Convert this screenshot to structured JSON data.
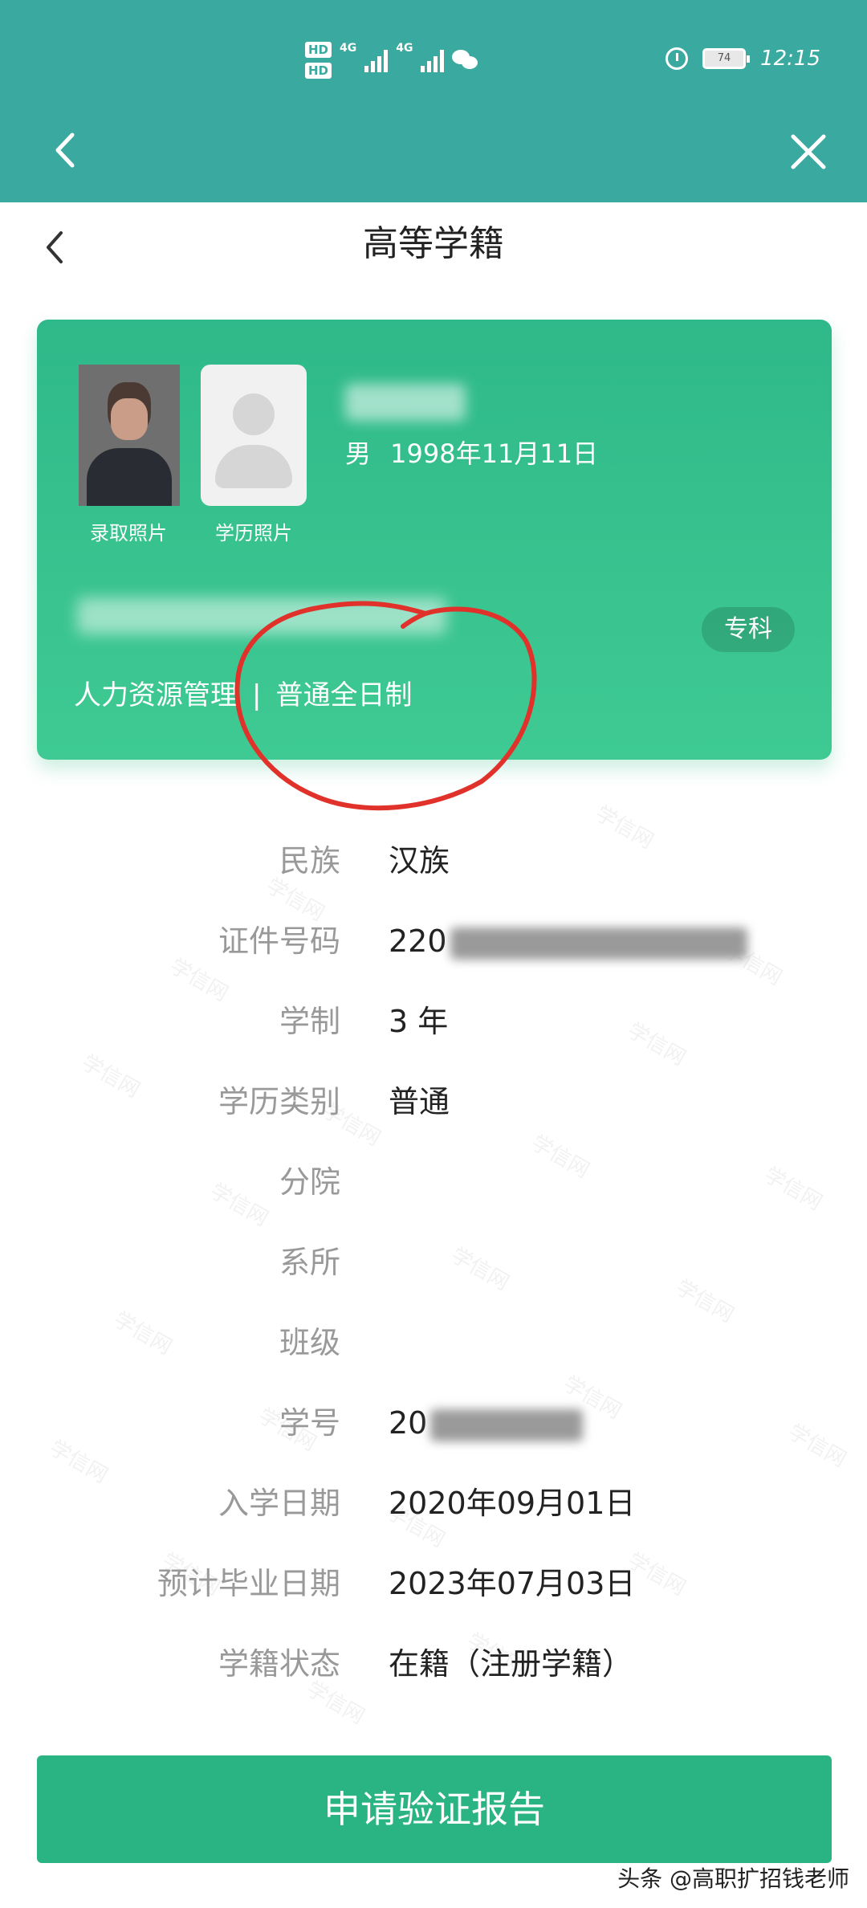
{
  "status_bar": {
    "hd1": "HD",
    "hd2": "HD",
    "net1": "4G",
    "net2": "4G",
    "battery": "74",
    "time": "12:15"
  },
  "page": {
    "title": "高等学籍"
  },
  "card": {
    "photo_label_1": "录取照片",
    "photo_label_2": "学历照片",
    "gender_dob": "男 1998年11月11日",
    "level_badge": "专科",
    "major": "人力资源管理",
    "separator": "|",
    "study_mode": "普通全日制"
  },
  "fields": [
    {
      "label": "民族",
      "value": "汉族"
    },
    {
      "label": "证件号码",
      "value": "220"
    },
    {
      "label": "学制",
      "value": "3 年"
    },
    {
      "label": "学历类别",
      "value": "普通"
    },
    {
      "label": "分院",
      "value": ""
    },
    {
      "label": "系所",
      "value": ""
    },
    {
      "label": "班级",
      "value": ""
    },
    {
      "label": "学号",
      "value": "20"
    },
    {
      "label": "入学日期",
      "value": "2020年09月01日"
    },
    {
      "label": "预计毕业日期",
      "value": "2023年07月03日"
    },
    {
      "label": "学籍状态",
      "value": "在籍（注册学籍）"
    }
  ],
  "watermark": "学信网",
  "cta": {
    "label": "申请验证报告"
  },
  "source_tag": "头条 @高职扩招钱老师",
  "colors": {
    "header": "#3aa9a0",
    "card": "#2fb98a",
    "button": "#2bb483",
    "annotation": "#e0322a"
  }
}
